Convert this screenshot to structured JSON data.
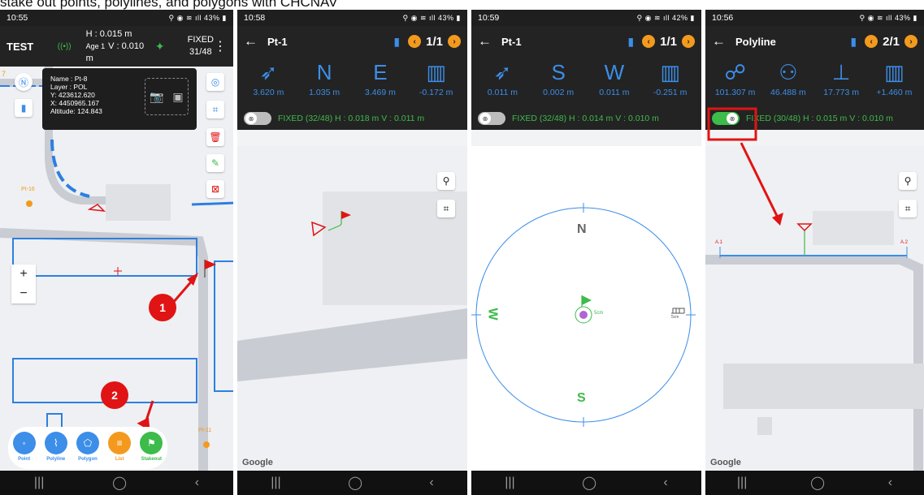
{
  "caption": "stake out points, polylines, and polygons with CHCNAV",
  "screens": [
    {
      "status_time": "10:55",
      "status_right": "⚲ ◉ ≋ ıll 43% ▮",
      "project": "TEST",
      "h_value": "H : 0.015 m",
      "v_value": "V : 0.010 m",
      "age": "Age 1",
      "fix_status": "FIXED",
      "sat_count": "31/48",
      "info": {
        "name": "Name : Pt-8",
        "layer": "Layer : POL",
        "y": "Y: 423612.620",
        "x": "X: 4450965.167",
        "altitude": "Altitude: 124.843"
      },
      "labels": {
        "pt16": "Pt-16",
        "pt11": "Pt-11",
        "edge": "7"
      },
      "zoom_in": "+",
      "zoom_out": "−",
      "toolbar": [
        {
          "label": "Point",
          "icon": "point-icon"
        },
        {
          "label": "Polyline",
          "icon": "polyline-icon"
        },
        {
          "label": "Polygon",
          "icon": "polygon-icon"
        },
        {
          "label": "List",
          "icon": "list-icon"
        },
        {
          "label": "Stakeout",
          "icon": "stakeout-icon"
        }
      ],
      "badge1": "1",
      "badge2": "2"
    },
    {
      "status_time": "10:58",
      "status_right": "⚲ ◉ ≋ ıll 43% ▮",
      "title": "Pt-1",
      "counter": "1/1",
      "metrics": [
        {
          "big": "",
          "value": "3.620 m",
          "icon": "distance-icon"
        },
        {
          "big": "N",
          "value": "1.035 m"
        },
        {
          "big": "E",
          "value": "3.469 m"
        },
        {
          "big": "",
          "value": "-0.172 m",
          "icon": "height-icon"
        }
      ],
      "fix_line": "FIXED (32/48)  H : 0.018 m  V : 0.011 m",
      "google": "Google"
    },
    {
      "status_time": "10:59",
      "status_right": "⚲ ◉ ≋ ıll 42% ▮",
      "title": "Pt-1",
      "counter": "1/1",
      "metrics": [
        {
          "big": "",
          "value": "0.011 m",
          "icon": "distance-icon"
        },
        {
          "big": "S",
          "value": "0.002 m"
        },
        {
          "big": "W",
          "value": "0.011 m"
        },
        {
          "big": "",
          "value": "-0.251 m",
          "icon": "height-icon"
        }
      ],
      "fix_line": "FIXED (32/48)  H : 0.014 m  V : 0.010 m",
      "compass": {
        "n": "N",
        "s": "S",
        "w": "W",
        "scale": "5cm",
        "east_scale": "5cm"
      }
    },
    {
      "status_time": "10:56",
      "status_right": "⚲ ◉ ≋ ıll 43% ▮",
      "title": "Polyline",
      "counter": "2/1",
      "metrics": [
        {
          "big": "",
          "value": "101.307 m",
          "icon": "polyline-length-icon"
        },
        {
          "big": "",
          "value": "46.488 m",
          "icon": "station-icon"
        },
        {
          "big": "",
          "value": "17.773 m",
          "icon": "offset-icon"
        },
        {
          "big": "",
          "value": "+1.460 m",
          "icon": "height-icon"
        }
      ],
      "fix_line": "FIXED (30/48)  H : 0.015 m  V : 0.010 m",
      "labels": {
        "a1": "A.1",
        "a2": "A.2"
      },
      "google": "Google"
    }
  ],
  "nav": {
    "recent": "|||",
    "home": "◯",
    "back": "‹"
  },
  "colors": {
    "accent": "#3c8ee8",
    "fixed": "#3dbb4b",
    "orange": "#f39a1e",
    "red": "#e01414",
    "header": "#232323"
  }
}
